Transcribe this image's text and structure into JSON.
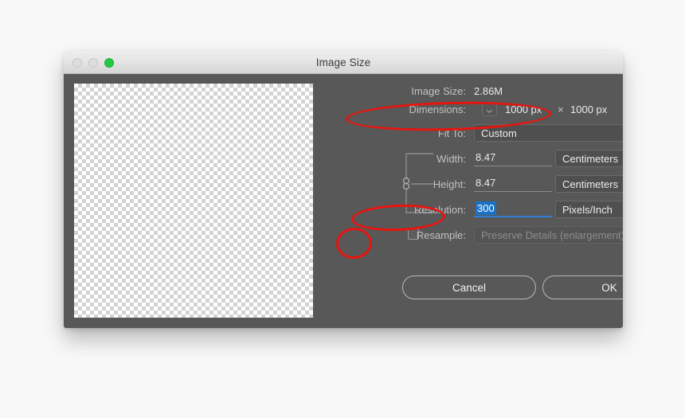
{
  "window": {
    "title": "Image Size",
    "traffic_lights": [
      {
        "name": "close",
        "color": "#dedede",
        "enabled": false
      },
      {
        "name": "minimize",
        "color": "#dedede",
        "enabled": false
      },
      {
        "name": "zoom",
        "color": "#23c940",
        "enabled": true
      }
    ]
  },
  "panel": {
    "gear_icon": "gear-icon",
    "image_size": {
      "label": "Image Size:",
      "value": "2.86M"
    },
    "dimensions": {
      "label": "Dimensions:",
      "width_value": "1000 px",
      "separator": "×",
      "height_value": "1000 px"
    },
    "fit_to": {
      "label": "Fit To:",
      "value": "Custom"
    },
    "width": {
      "label": "Width:",
      "value": "8.47",
      "unit": "Centimeters"
    },
    "height": {
      "label": "Height:",
      "value": "8.47",
      "unit": "Centimeters"
    },
    "resolution": {
      "label": "Resolution:",
      "value": "300",
      "unit": "Pixels/Inch",
      "selected": true
    },
    "resample": {
      "label": "Resample:",
      "checked": false,
      "method": "Preserve Details (enlargement)",
      "disabled": true
    }
  },
  "buttons": {
    "cancel": "Cancel",
    "ok": "OK"
  },
  "annotations": [
    {
      "name": "dimensions-highlight",
      "color": "#e8140f"
    },
    {
      "name": "resolution-highlight",
      "color": "#e8140f"
    },
    {
      "name": "resample-checkbox-highlight",
      "color": "#e8140f"
    }
  ],
  "colors": {
    "window_body": "#585858",
    "titlebar": "#e4e4e4",
    "accent_selection": "#1a72c6",
    "annotation": "#e8140f"
  }
}
